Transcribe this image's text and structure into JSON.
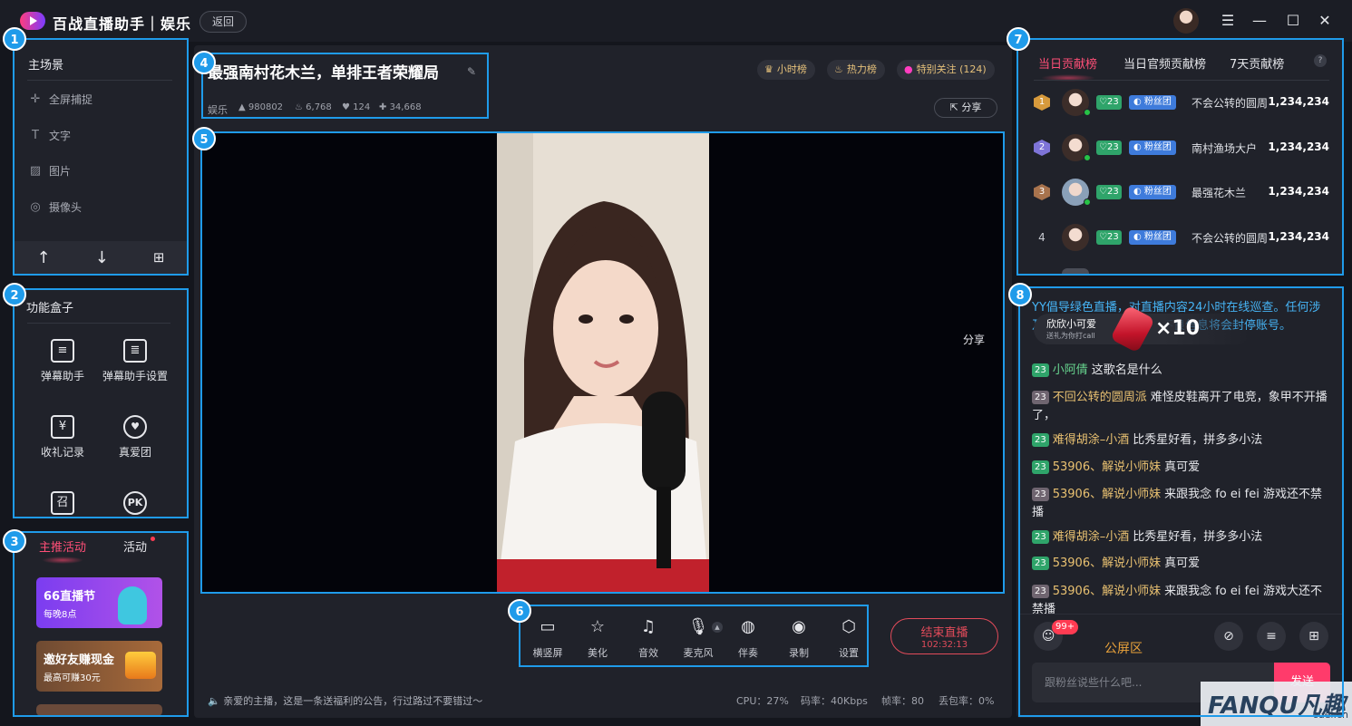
{
  "app": {
    "title": "百战直播助手｜娱乐",
    "back_label": "返回"
  },
  "window_controls": [
    "☰",
    "—",
    "☐",
    "✕"
  ],
  "badges": [
    "1",
    "2",
    "3",
    "4",
    "5",
    "6",
    "7",
    "8"
  ],
  "scenes": {
    "title": "主场景",
    "items": [
      {
        "label": "全屏捕捉",
        "icon": "crosshair-icon"
      },
      {
        "label": "文字",
        "icon": "text-icon"
      },
      {
        "label": "图片",
        "icon": "image-icon"
      },
      {
        "label": "摄像头",
        "icon": "camera-icon"
      }
    ],
    "tools": [
      "arrow-up-icon",
      "arrow-down-icon",
      "add-folder-icon"
    ]
  },
  "function_box": {
    "title": "功能盒子",
    "items": [
      {
        "label": "弹幕助手",
        "icon": "danmu-icon"
      },
      {
        "label": "弹幕助手设置",
        "icon": "danmu-settings-icon"
      },
      {
        "label": "收礼记录",
        "icon": "yen-icon"
      },
      {
        "label": "真爱团",
        "icon": "heart-wings-icon"
      },
      {
        "label": "",
        "icon": "summon-icon",
        "glyph": "召"
      },
      {
        "label": "",
        "icon": "pk-icon",
        "glyph": "PK"
      }
    ]
  },
  "activity": {
    "tabs": [
      "主推活动",
      "活动"
    ],
    "banners": [
      {
        "title": "66直播节",
        "subtitle": "每晚8点"
      },
      {
        "title": "邀好友赚现金",
        "subtitle": "最高可赚30元"
      }
    ]
  },
  "stream": {
    "title": "最强南村花木兰，单排王者荣耀局",
    "category": "娱乐",
    "stats": [
      {
        "icon": "fire-icon",
        "value": "980802"
      },
      {
        "icon": "flame-icon",
        "value": "6,768"
      },
      {
        "icon": "heart-icon",
        "value": "124"
      },
      {
        "icon": "thumb-icon",
        "value": "34,668"
      }
    ],
    "pills": [
      {
        "icon": "crown-icon",
        "label": "小时榜"
      },
      {
        "icon": "flame-icon",
        "label": "热力榜"
      },
      {
        "icon": "heart-icon",
        "label": "特别关注 (124)"
      }
    ],
    "share_label": "分享",
    "video_share_label": "分享"
  },
  "controls": [
    {
      "label": "横竖屏",
      "icon": "rotate-screen-icon"
    },
    {
      "label": "美化",
      "icon": "beauty-icon"
    },
    {
      "label": "音效",
      "icon": "music-icon"
    },
    {
      "label": "麦克风",
      "icon": "microphone-icon"
    },
    {
      "label": "伴奏",
      "icon": "accompaniment-icon"
    },
    {
      "label": "录制",
      "icon": "record-icon"
    },
    {
      "label": "设置",
      "icon": "settings-icon"
    }
  ],
  "end_live": {
    "label": "结束直播",
    "time": "102:32:13"
  },
  "footer": {
    "notice": "亲爱的主播，这是一条送福利的公告，行过路过不要错过～",
    "cpu": "CPU：27%",
    "bitrate": "码率：40Kbps",
    "fps": "帧率：80",
    "packet_loss": "丢包率：0%"
  },
  "ranking": {
    "tabs": [
      "当日贡献榜",
      "当日官频贡献榜",
      "7天贡献榜"
    ],
    "help": "?",
    "rows": [
      {
        "rank": "1",
        "level": "23",
        "fans": "粉丝团",
        "name": "不会公转的圆周",
        "score": "1,234,234"
      },
      {
        "rank": "2",
        "level": "23",
        "fans": "粉丝团",
        "name": "南村渔场大户",
        "score": "1,234,234"
      },
      {
        "rank": "3",
        "level": "23",
        "fans": "粉丝团",
        "name": "最强花木兰",
        "score": "1,234,234"
      },
      {
        "rank": "4",
        "level": "23",
        "fans": "粉丝团",
        "name": "不会公转的圆周",
        "score": "1,234,234"
      }
    ]
  },
  "chat": {
    "notice": "YY倡导绿色直播，对直播内容24小时在线巡查。任何涉及违法违规、色情低俗等不良信息将会封停账号。",
    "gift": {
      "user": "欣欣小可爱",
      "desc": "送礼为你打call",
      "count": "×10"
    },
    "messages": [
      {
        "level": "23",
        "user": "小阿倩",
        "text": "这歌名是什么",
        "gray": false
      },
      {
        "level": "23",
        "user": "不回公转的圆周派",
        "text": "难怪皮鞋离开了电竞，象甲不开播了，",
        "gray": true
      },
      {
        "level": "23",
        "user": "难得胡涂–小酒",
        "text": "比秀星好看，拼多多小法",
        "gray": false
      },
      {
        "level": "23",
        "user": "53906、解说小师妹",
        "text": "真可爱",
        "gray": false
      },
      {
        "level": "23",
        "user": "53906、解说小师妹",
        "text": "来跟我念 fo ei fei 游戏还不禁播",
        "gray": true
      },
      {
        "level": "23",
        "user": "难得胡涂–小酒",
        "text": "比秀星好看，拼多多小法",
        "gray": false
      },
      {
        "level": "23",
        "user": "53906、解说小师妹",
        "text": "真可爱",
        "gray": false
      },
      {
        "level": "23",
        "user": "53906、解说小师妹",
        "text": "来跟我念 fo ei fei 游戏大还不禁播",
        "gray": true
      }
    ],
    "unread": "99+",
    "zone_label": "公屏区",
    "input_placeholder": "跟粉丝说些什么吧...",
    "send_label": "发送"
  },
  "watermark": {
    "brand": "FANQU凡趣",
    "site": "cuel.cn"
  }
}
